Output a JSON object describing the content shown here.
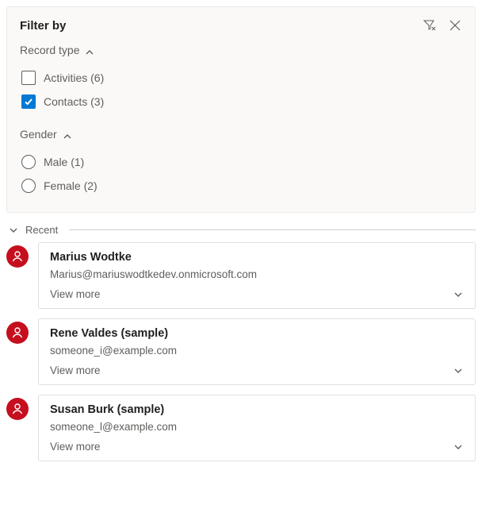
{
  "filter": {
    "title": "Filter by",
    "sections": {
      "record_type": {
        "label": "Record type",
        "options": [
          {
            "label": "Activities (6)",
            "checked": false
          },
          {
            "label": "Contacts (3)",
            "checked": true
          }
        ]
      },
      "gender": {
        "label": "Gender",
        "options": [
          {
            "label": "Male (1)"
          },
          {
            "label": "Female (2)"
          }
        ]
      }
    }
  },
  "recent": {
    "label": "Recent",
    "items": [
      {
        "name": "Marius Wodtke",
        "email": "Marius@mariuswodtkedev.onmicrosoft.com",
        "view_more": "View more"
      },
      {
        "name": "Rene Valdes (sample)",
        "email": "someone_i@example.com",
        "view_more": "View more"
      },
      {
        "name": "Susan Burk (sample)",
        "email": "someone_l@example.com",
        "view_more": "View more"
      }
    ]
  },
  "colors": {
    "accent": "#0078d4",
    "avatar": "#c50f1f"
  }
}
